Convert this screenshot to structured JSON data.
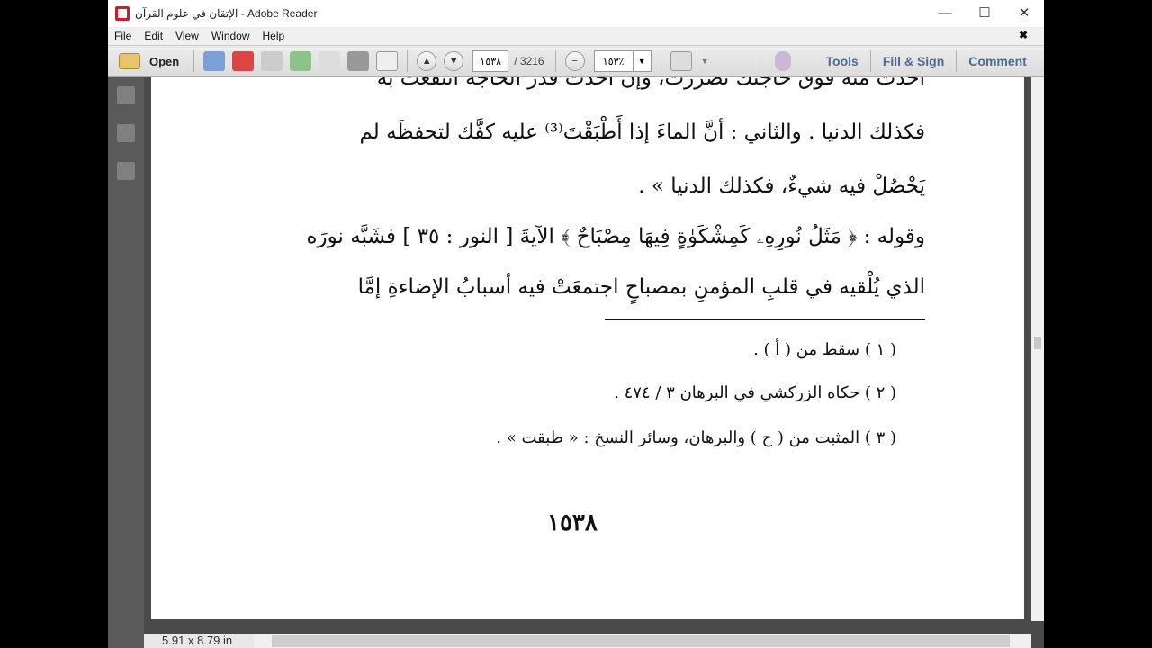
{
  "window": {
    "title": "الإتقان في علوم القرآن - Adobe Reader",
    "minimize": "—",
    "maximize": "☐",
    "close": "✕"
  },
  "menu": {
    "items": [
      "File",
      "Edit",
      "View",
      "Window",
      "Help"
    ],
    "close_doc": "✖"
  },
  "toolbar": {
    "open_label": "Open",
    "page_current": "١٥٣٨",
    "page_total": "/ 3216",
    "zoom": "١٥٣٪",
    "zoom_out": "−",
    "tools": "Tools",
    "fill_sign": "Fill & Sign",
    "comment": "Comment"
  },
  "page": {
    "lines": [
      "أخذت منه فوق حاجتك تضررت، وإن أخذت قدر الحاجة انتفعت به",
      "فكذلك الدنيا . والثاني : أنَّ الماءَ إذا أَطْبَقْتَ⁽³⁾ عليه كفَّك لتحفظَه لم",
      "يَحْصُلْ فيه شيءٌ، فكذلك الدنيا » .",
      "وقوله : ﴿ مَثَلُ نُورِهِۦ كَمِشْكَوٰةٍ فِيهَا مِصْبَاحٌ ﴾ الآيةَ [ النور : ٣٥ ] فشَبَّه نورَه",
      "الذي يُلْقيه في قلبِ المؤمنِ بمصباحٍ اجتمعَتْ فيه أسبابُ الإضاءةِ إمَّا"
    ],
    "footnotes": [
      "( ١ ) سقط من ( أ ) .",
      "( ٢ ) حكاه الزركشي في البرهان ٣ / ٤٧٤ .",
      "( ٣ ) المثبت من ( ح ) والبرهان، وسائر النسخ : « طبقت » ."
    ],
    "page_number": "١٥٣٨"
  },
  "status": {
    "page_size": "5.91 x 8.79 in"
  }
}
